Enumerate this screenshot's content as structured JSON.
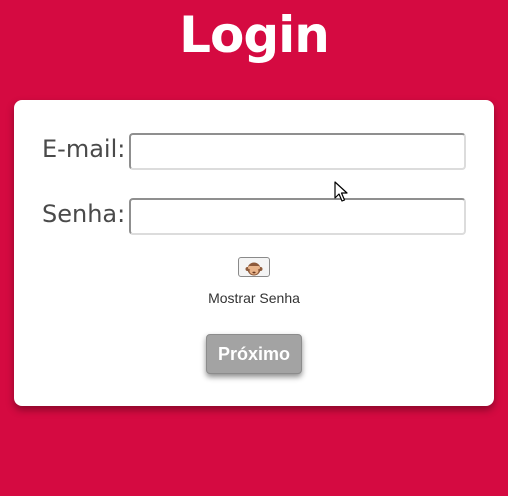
{
  "page": {
    "title": "Login"
  },
  "form": {
    "email_label": "E-mail:",
    "email_value": "",
    "password_label": "Senha:",
    "password_value": "",
    "toggle_icon": "see-no-evil-monkey-emoji",
    "show_password_label": "Mostrar Senha",
    "next_button_label": "Próximo"
  },
  "colors": {
    "background": "#d50a41",
    "card": "#ffffff",
    "button": "#a3a3a3",
    "title_text": "#ffffff"
  }
}
